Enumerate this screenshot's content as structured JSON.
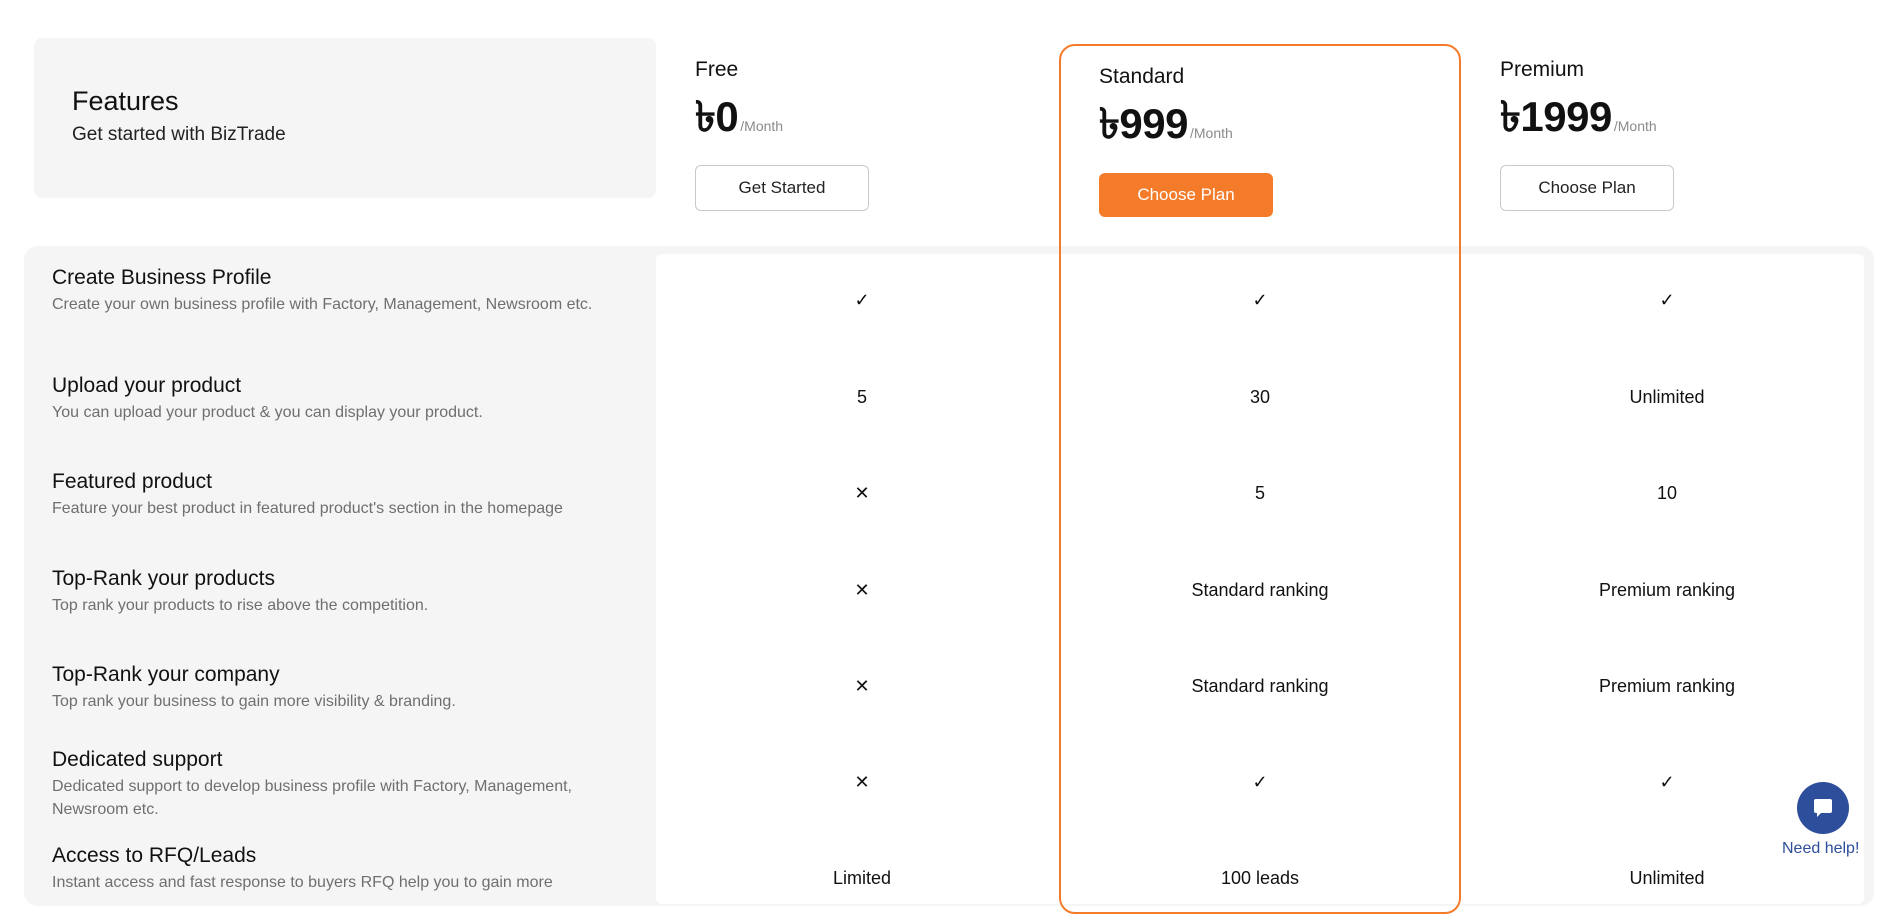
{
  "features_header": {
    "title": "Features",
    "subtitle": "Get started with BizTrade"
  },
  "plans": [
    {
      "name": "Free",
      "price": "৳0",
      "period": "/Month",
      "button": "Get Started"
    },
    {
      "name": "Standard",
      "price": "৳999",
      "period": "/Month",
      "button": "Choose Plan"
    },
    {
      "name": "Premium",
      "price": "৳1999",
      "period": "/Month",
      "button": "Choose Plan"
    }
  ],
  "colors": {
    "accent": "#f47b2a",
    "help": "#2d4e9a"
  },
  "rows": [
    {
      "title": "Create Business Profile",
      "desc": "Create your own business profile with Factory, Management, Newsroom etc.",
      "free": "✓",
      "standard": "✓",
      "premium": "✓"
    },
    {
      "title": "Upload your product",
      "desc": "You can upload your product & you can display your product.",
      "free": "5",
      "standard": "30",
      "premium": "Unlimited"
    },
    {
      "title": "Featured product",
      "desc": "Feature your best product in featured product's section in the homepage",
      "free": "✕",
      "standard": "5",
      "premium": "10"
    },
    {
      "title": "Top-Rank your products",
      "desc": "Top rank your products to rise above the competition.",
      "free": "✕",
      "standard": "Standard ranking",
      "premium": "Premium ranking"
    },
    {
      "title": "Top-Rank your company",
      "desc": "Top rank your business to gain more visibility & branding.",
      "free": "✕",
      "standard": "Standard ranking",
      "premium": "Premium ranking"
    },
    {
      "title": "Dedicated support",
      "desc": "Dedicated support to develop business profile with Factory, Management, Newsroom etc.",
      "free": "✕",
      "standard": "✓",
      "premium": "✓"
    },
    {
      "title": "Access to RFQ/Leads",
      "desc": "Instant access and fast response to buyers RFQ help you to gain more",
      "free": "Limited",
      "standard": "100 leads",
      "premium": "Unlimited"
    }
  ],
  "help": {
    "label": "Need help!",
    "icon": "chat-icon"
  }
}
